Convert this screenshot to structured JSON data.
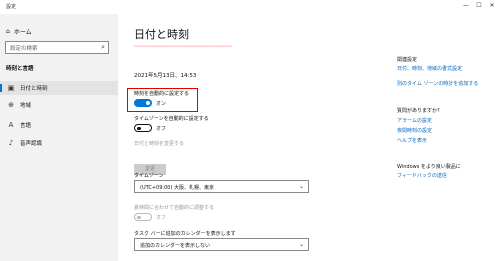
{
  "window": {
    "title": "設定",
    "minimize": "—",
    "maximize": "☐",
    "close": "✕"
  },
  "sidebar": {
    "home_label": "ホーム",
    "search_placeholder": "設定の検索",
    "section_title": "時刻と言語",
    "items": [
      {
        "label": "日付と時刻",
        "icon": "calendar-icon",
        "active": true
      },
      {
        "label": "地域",
        "icon": "globe-icon",
        "active": false
      },
      {
        "label": "言語",
        "icon": "language-icon",
        "active": false
      },
      {
        "label": "音声認識",
        "icon": "microphone-icon",
        "active": false
      }
    ]
  },
  "main": {
    "title": "日付と時刻",
    "current_datetime": "2021年5月13日、14:53",
    "auto_time": {
      "label": "時刻を自動的に設定する",
      "state": "オン"
    },
    "auto_timezone": {
      "label": "タイムゾーンを自動的に設定する",
      "state": "オフ"
    },
    "change_datetime": {
      "label": "日付と時刻を変更する",
      "button": "変更"
    },
    "timezone": {
      "label": "タイムゾーン",
      "value": "(UTC+09:00) 大阪、札幌、東京"
    },
    "dst": {
      "label": "夏時間に合わせて自動的に調整する",
      "state": "オフ"
    },
    "taskbar_calendar": {
      "label": "タスク バーに追加のカレンダーを表示します",
      "value": "追加のカレンダーを表示しない"
    }
  },
  "related": {
    "heading": "関連設定",
    "links": [
      "日付、時刻、地域の書式設定",
      "別のタイム ゾーンの時計を追加する"
    ],
    "help_heading": "質問がありますか?",
    "help_links": [
      "アラームの設定",
      "夜間時刻の設定",
      "ヘルプを表示"
    ],
    "feedback_heading": "Windows をより良い製品に",
    "feedback_link": "フィードバックの送信"
  },
  "colors": {
    "accent": "#0078d7",
    "highlight": "#e00000",
    "link": "#0067c0"
  }
}
